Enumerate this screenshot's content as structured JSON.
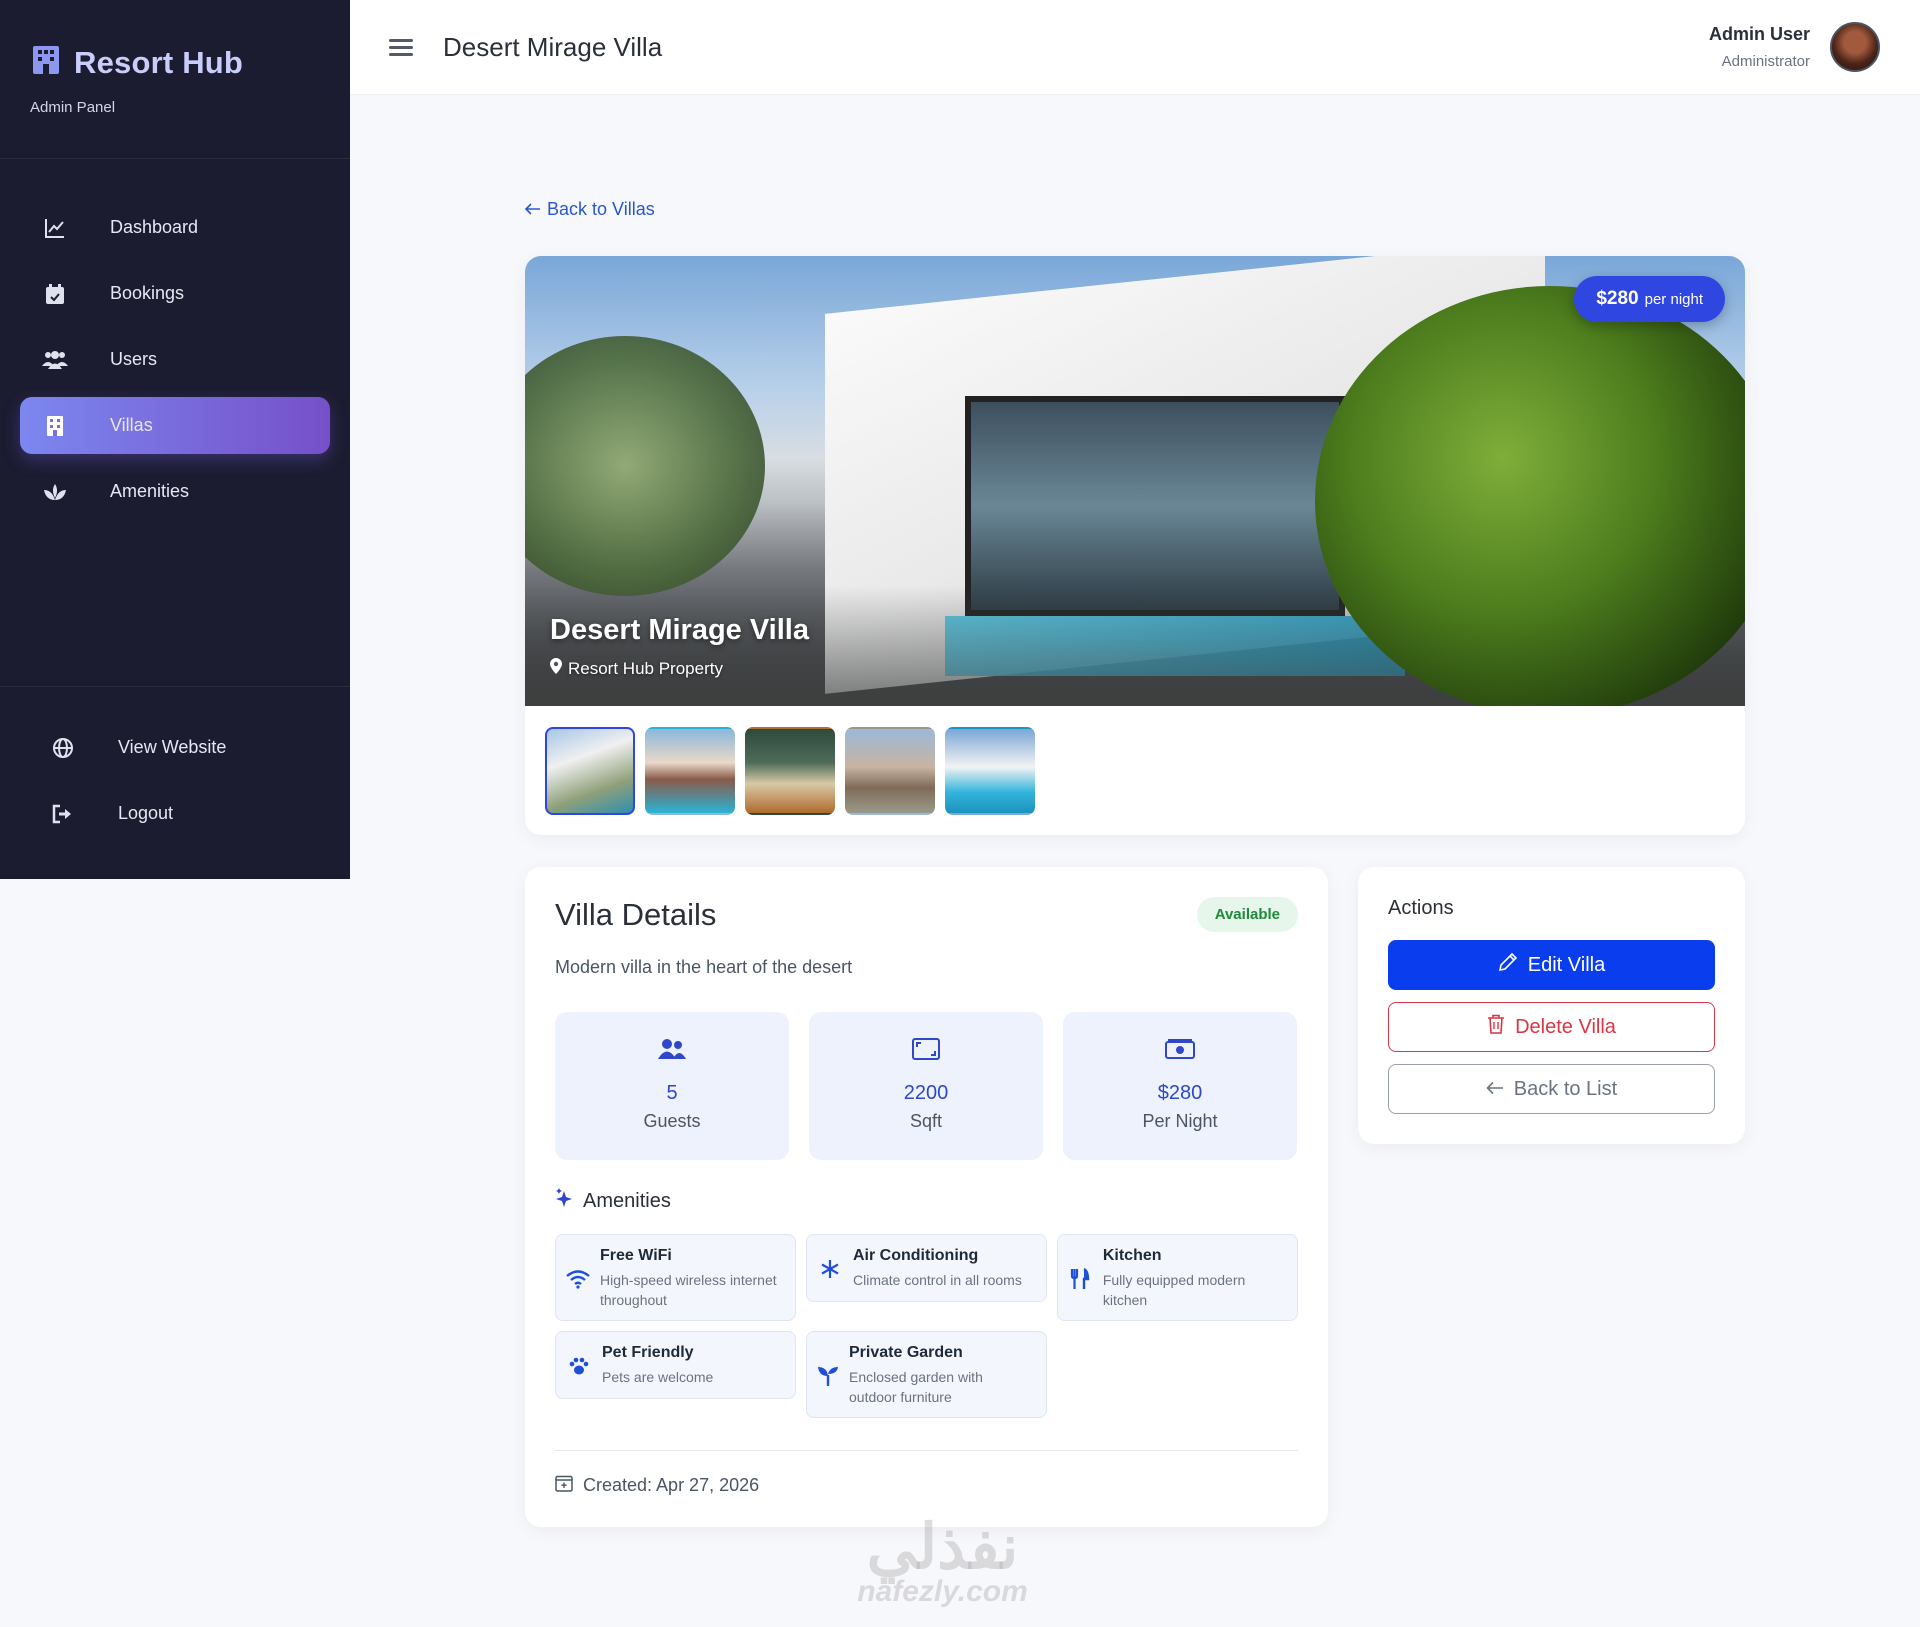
{
  "sidebar": {
    "brand": "Resort Hub",
    "subtitle": "Admin Panel",
    "items": [
      {
        "label": "Dashboard",
        "icon": "chart-line-icon"
      },
      {
        "label": "Bookings",
        "icon": "calendar-check-icon"
      },
      {
        "label": "Users",
        "icon": "users-icon"
      },
      {
        "label": "Villas",
        "icon": "building-icon",
        "active": true
      },
      {
        "label": "Amenities",
        "icon": "spa-icon"
      }
    ],
    "bottom": [
      {
        "label": "View Website",
        "icon": "globe-icon"
      },
      {
        "label": "Logout",
        "icon": "logout-icon"
      }
    ]
  },
  "header": {
    "title": "Desert Mirage Villa",
    "user_name": "Admin User",
    "user_role": "Administrator"
  },
  "back_link": "Back to Villas",
  "hero": {
    "title": "Desert Mirage Villa",
    "location": "Resort Hub Property",
    "price": "$280",
    "price_unit": "per night"
  },
  "details": {
    "title": "Villa Details",
    "status": "Available",
    "description": "Modern villa in the heart of the desert",
    "stats": [
      {
        "value": "5",
        "label": "Guests",
        "icon": "users-icon"
      },
      {
        "value": "2200",
        "label": "Sqft",
        "icon": "area-icon"
      },
      {
        "value": "$280",
        "label": "Per Night",
        "icon": "money-icon"
      }
    ],
    "amenities_title": "Amenities",
    "amenities": [
      {
        "name": "Free WiFi",
        "desc": "High-speed wireless internet throughout",
        "icon": "wifi-icon"
      },
      {
        "name": "Air Conditioning",
        "desc": "Climate control in all rooms",
        "icon": "snowflake-icon"
      },
      {
        "name": "Kitchen",
        "desc": "Fully equipped modern kitchen",
        "icon": "utensils-icon"
      },
      {
        "name": "Pet Friendly",
        "desc": "Pets are welcome",
        "icon": "paw-icon"
      },
      {
        "name": "Private Garden",
        "desc": "Enclosed garden with outdoor furniture",
        "icon": "seedling-icon"
      }
    ],
    "created": "Created: Apr 27, 2026"
  },
  "actions": {
    "title": "Actions",
    "edit": "Edit Villa",
    "delete": "Delete Villa",
    "back": "Back to List"
  },
  "watermark": {
    "arabic": "نفذلي",
    "latin": "nafezly.com"
  },
  "colors": {
    "sidebar_bg": "#1c1c30",
    "accent": "#2f47e0",
    "primary_button": "#0a3ded",
    "danger": "#dc3545",
    "success": "#1f8a3a"
  }
}
